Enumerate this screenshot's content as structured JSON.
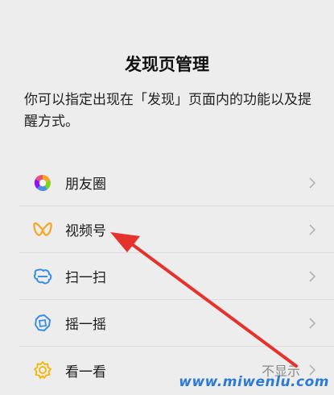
{
  "page": {
    "title": "发现页管理",
    "description": "你可以指定出现在「发现」页面内的功能以及提醒方式。"
  },
  "menu": {
    "items": [
      {
        "label": "朋友圈",
        "icon": "moments-icon",
        "status": ""
      },
      {
        "label": "视频号",
        "icon": "channels-icon",
        "status": ""
      },
      {
        "label": "扫一扫",
        "icon": "scan-icon",
        "status": ""
      },
      {
        "label": "摇一摇",
        "icon": "shake-icon",
        "status": ""
      },
      {
        "label": "看一看",
        "icon": "top-stories-icon",
        "status": "不显示"
      }
    ]
  },
  "watermark": {
    "text": "www.miwenlu.com"
  },
  "colors": {
    "background": "#ededed",
    "annotation_arrow": "#e5322d",
    "watermark": "#2b7bd6"
  }
}
